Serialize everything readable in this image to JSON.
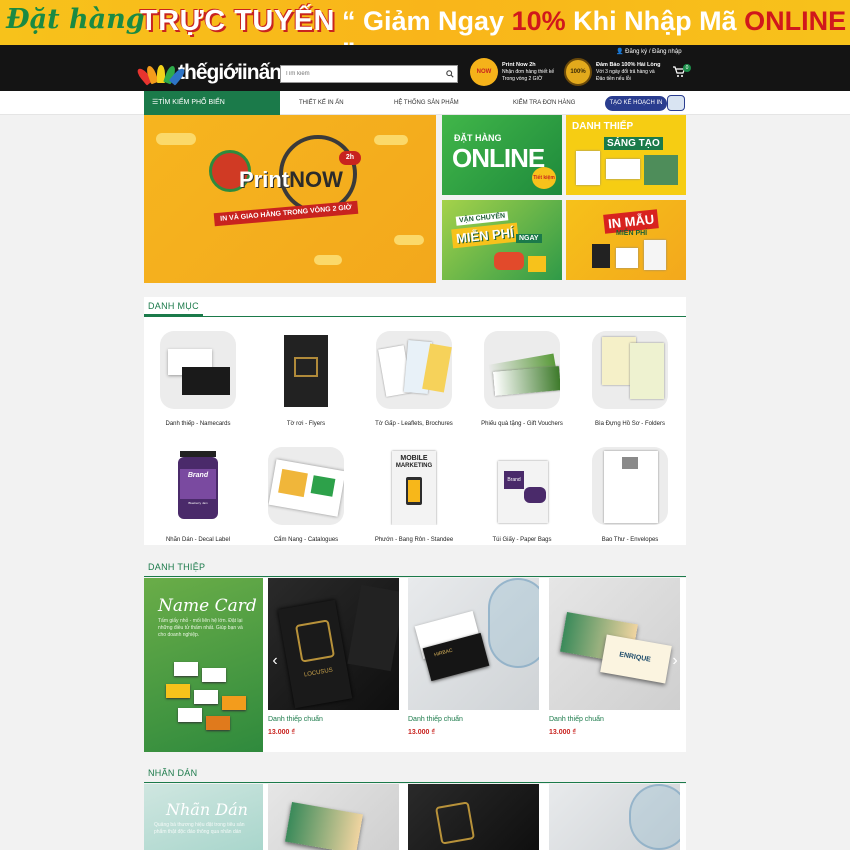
{
  "promo": {
    "script": "Đặt hàng",
    "strong": "TRỰC TUYẾN",
    "quote_pre": "“ Giảm Ngay ",
    "percent": "10%",
    "quote_mid": " Khi Nhập Mã ",
    "code": "ONLINE",
    "quote_end": " ”"
  },
  "header": {
    "logo": "thếgiớiinấn",
    "search_placeholder": "Tìm kiếm",
    "badge1": {
      "icon": "NOW",
      "title": "Print Now 2h",
      "line1": "Nhận đơn hàng thiết kế",
      "line2": "Trong vòng 2 GIỜ"
    },
    "badge2": {
      "icon": "100%",
      "title": "Đảm Bảo 100% Hài Lòng",
      "line1": "Với 3 ngày đổi trả hàng và",
      "line2": "Đảo tiền nếu lỗi"
    },
    "account": "Đăng ký / Đăng nhập",
    "cart_count": "0"
  },
  "nav": {
    "category": "TÌM KIẾM PHỔ BIẾN",
    "items": [
      "THIẾT KẾ IN ẤN",
      "HỆ THỐNG SẢN PHẨM",
      "KIỂM TRA ĐƠN HÀNG"
    ],
    "plan": "TẠO KẾ HOẠCH IN"
  },
  "hero": {
    "title_a": "Print",
    "title_b": "NOW",
    "hours": "2h",
    "tagline": "IN VÀ GIAO HÀNG TRONG VÒNG 2 GIỜ"
  },
  "tiles": {
    "online_top": "ĐẶT HÀNG",
    "online_main": "ONLINE",
    "online_sticker": "Tiết kiệm",
    "card_top": "DANH THIẾP",
    "card_main": "SÁNG TẠO",
    "ship_top": "VẬN CHUYỂN",
    "ship_main": "MIỄN PHÍ",
    "ship_sub": "NGAY",
    "print_main": "IN MẪU",
    "print_sub": "MIỄN PHÍ"
  },
  "categories": {
    "title": "DANH MỤC",
    "items": [
      "Danh thiếp - Namecards",
      "Tờ rơi - Flyers",
      "Tờ Gấp - Leaflets, Brochures",
      "Phiếu quà tặng - Gift Vouchers",
      "Bìa Đựng Hồ Sơ - Folders",
      "Nhãn Dán - Decal Label",
      "Cẩm Nang - Catalogues",
      "Phướn - Bang Rôn - Standee",
      "Túi Giấy - Paper Bags",
      "Bao Thư - Envelopes"
    ],
    "inner_text": {
      "brand": "Brand",
      "jar_sub": "Blueberry Jam",
      "mobile": "MOBILE",
      "marketing": "MARKETING"
    }
  },
  "namecard_section": {
    "title": "DANH THIỆP",
    "banner_title": "Name Card",
    "banner_text": "Tấm giấy nhỏ - mối liên hệ lớn. Đặt lại những điều tử thấm nhất. Giúp bạn và cho doanh nghiệp.",
    "products": [
      {
        "name": "Danh thiếp chuẩn",
        "price": "13.000 ₫",
        "brand": "LOCUSUS"
      },
      {
        "name": "Danh thiếp chuẩn",
        "price": "13.000 ₫",
        "brand": "HIRBAC"
      },
      {
        "name": "Danh thiếp chuẩn",
        "price": "13.000 ₫",
        "brand": "ENRIQUE"
      }
    ],
    "prev": "‹",
    "next": "›"
  },
  "sticker_section": {
    "title": "NHÃN DÁN",
    "banner_title": "Nhãn Dán",
    "banner_text": "Quảng bá thương hiệu đặt trong tiêu sản phẩm thật độc đáo thông qua nhãn dán"
  },
  "colors": {
    "green": "#1b7a4a",
    "yellow": "#f7c21b",
    "red": "#c8231f",
    "black": "#141414"
  }
}
